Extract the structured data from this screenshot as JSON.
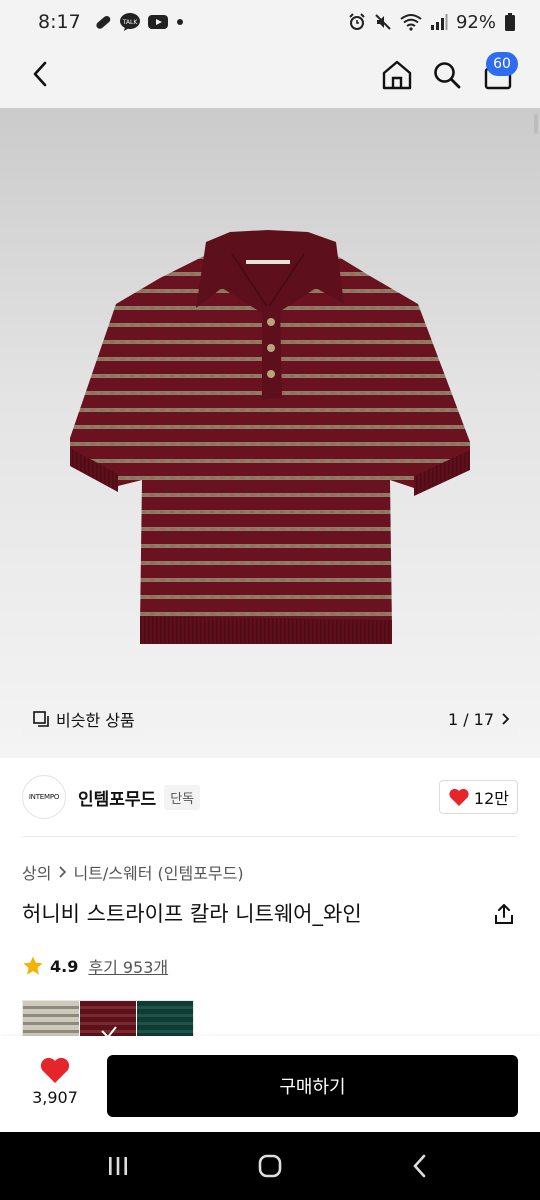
{
  "status_bar": {
    "time": "8:17",
    "battery": "92%",
    "icons": [
      "pill-icon",
      "kakaotalk-icon",
      "youtube-icon",
      "dot-icon",
      "alarm-icon",
      "mute-icon",
      "wifi-icon",
      "signal-icon",
      "battery-icon"
    ]
  },
  "header": {
    "icons": [
      "back-arrow-icon",
      "home-icon",
      "search-icon",
      "cart-icon"
    ],
    "cart_count": "60"
  },
  "gallery": {
    "similar_label": "비슷한 상품",
    "page_indicator": "1 / 17",
    "colors": {
      "sweater": "#6b1220",
      "stripe": "#8a7f66",
      "background": "#dcdcdc"
    }
  },
  "brand": {
    "logo_text": "INTEMPO",
    "name": "인템포무드",
    "tag": "단독",
    "likes": "12만"
  },
  "breadcrumb": {
    "level1": "상의",
    "level2": "니트/스웨터 (인템포무드)"
  },
  "product": {
    "title": "허니비 스트라이프 칼라 니트웨어_와인"
  },
  "rating": {
    "score": "4.9",
    "reviews": "후기 953개"
  },
  "color_options": [
    "beige-stripe",
    "wine-stripe",
    "green-stripe"
  ],
  "bottom_bar": {
    "wishlist_count": "3,907",
    "buy_label": "구매하기",
    "accent": "#e5252a"
  },
  "nav": {
    "icons": [
      "recent-apps-icon",
      "home-circle-icon",
      "back-chevron-icon"
    ]
  }
}
